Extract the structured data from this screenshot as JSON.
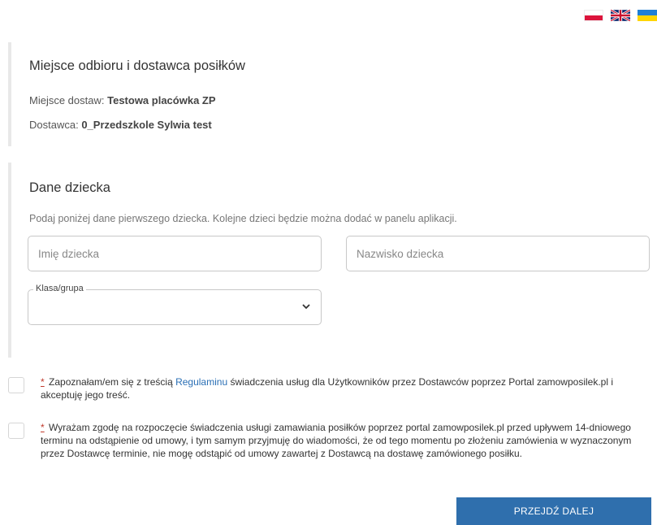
{
  "languages": [
    {
      "code": "pl",
      "icon": "poland-flag-icon"
    },
    {
      "code": "en",
      "icon": "uk-flag-icon"
    },
    {
      "code": "uk",
      "icon": "ukraine-flag-icon"
    }
  ],
  "pickup": {
    "title": "Miejsce odbioru i dostawca posiłków",
    "place_label": "Miejsce dostaw:",
    "place_value": "Testowa placówka ZP",
    "supplier_label": "Dostawca:",
    "supplier_value": "0_Przedszkole Sylwia test"
  },
  "child": {
    "title": "Dane dziecka",
    "hint": "Podaj poniżej dane pierwszego dziecka. Kolejne dzieci będzie można dodać w panelu aplikacji.",
    "first_name_placeholder": "Imię dziecka",
    "last_name_placeholder": "Nazwisko dziecka",
    "class_label": "Klasa/grupa",
    "class_value": ""
  },
  "consents": [
    {
      "required_mark": "*",
      "text_before": "Zapoznałam/em się z treścią ",
      "link": "Regulaminu",
      "text_after": " świadczenia usług dla Użytkowników przez Dostawców poprzez Portal zamowposilek.pl i akceptuję jego treść."
    },
    {
      "required_mark": "*",
      "text": "Wyrażam zgodę na rozpoczęcie świadczenia usługi zamawiania posiłków poprzez portal zamowposilek.pl przed upływem 14-dniowego terminu na odstąpienie od umowy, i tym samym przyjmuję do wiadomości, że od tego momentu po złożeniu zamówienia w wyznaczonym przez Dostawcę terminie, nie mogę odstąpić od umowy zawartej z Dostawcą na dostawę zamówionego posiłku."
    }
  ],
  "submit_label": "PRZEJDŹ DALEJ",
  "colors": {
    "accent": "#2f6fad",
    "link": "#2a6fb5",
    "required": "#c0392b"
  }
}
